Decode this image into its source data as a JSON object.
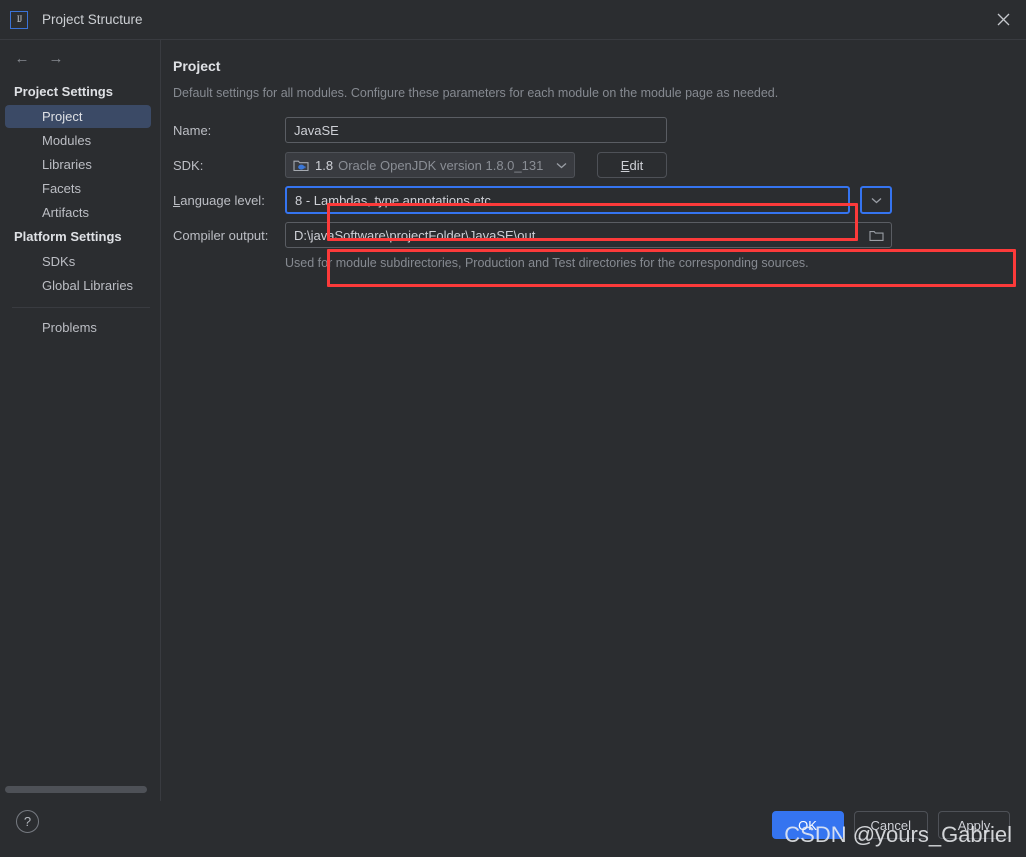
{
  "window": {
    "title": "Project Structure",
    "app_icon": "intellij-idea-icon",
    "close_icon": "close-icon"
  },
  "toolbar": {
    "back_icon": "arrow-left-icon",
    "forward_icon": "arrow-right-icon"
  },
  "sidebar": {
    "groups": [
      {
        "label": "Project Settings",
        "items": [
          {
            "label": "Project",
            "selected": true
          },
          {
            "label": "Modules",
            "selected": false
          },
          {
            "label": "Libraries",
            "selected": false
          },
          {
            "label": "Facets",
            "selected": false
          },
          {
            "label": "Artifacts",
            "selected": false
          }
        ]
      },
      {
        "label": "Platform Settings",
        "items": [
          {
            "label": "SDKs",
            "selected": false
          },
          {
            "label": "Global Libraries",
            "selected": false
          }
        ]
      }
    ],
    "problems": {
      "label": "Problems"
    }
  },
  "main": {
    "title": "Project",
    "description": "Default settings for all modules. Configure these parameters for each module on the module page as needed.",
    "name_row": {
      "label": "Name:",
      "value": "JavaSE"
    },
    "sdk_row": {
      "label": "SDK:",
      "icon": "java-sdk-folder-icon",
      "version": "1.8",
      "description": "Oracle OpenJDK version 1.8.0_131",
      "dropdown_icon": "chevron-down-icon",
      "edit_button": {
        "prefix": "E",
        "rest": "dit"
      }
    },
    "language_level_row": {
      "label_prefix": "L",
      "label_rest": "anguage level:",
      "value": "8 - Lambdas, type annotations etc.",
      "dropdown_icon": "chevron-down-icon"
    },
    "compiler_output_row": {
      "label": "Compiler output:",
      "value": "D:\\javaSoftware\\projectFolder\\JavaSE\\out",
      "browse_icon": "folder-icon",
      "hint": "Used for module subdirectories, Production and Test directories for the corresponding sources."
    }
  },
  "footer": {
    "help_label": "?",
    "ok_label": "OK",
    "cancel_label": "Cancel",
    "apply_label": "Apply"
  },
  "watermark": {
    "text": "CSDN @yours_Gabriel"
  },
  "colors": {
    "accent_blue": "#3574f0",
    "selection_blue": "#3b4a66",
    "annotation_red": "#fc3a3a",
    "background": "#2b2d30",
    "panel": "#393b40"
  }
}
